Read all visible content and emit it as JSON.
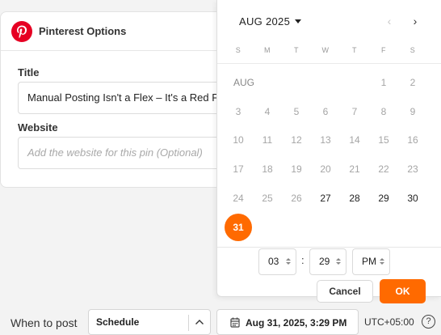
{
  "pinterest": {
    "title": "Pinterest Options",
    "fields": {
      "title_label": "Title",
      "title_value": "Manual Posting Isn't a Flex – It's a Red Flag",
      "website_label": "Website",
      "website_placeholder": "Add the website for this pin (Optional)"
    }
  },
  "calendar": {
    "month_label": "AUG 2025",
    "prev_icon": "chevron-left",
    "next_icon": "chevron-right",
    "weekdays": [
      "S",
      "M",
      "T",
      "W",
      "T",
      "F",
      "S"
    ],
    "month_abbr": "AUG",
    "weeks": [
      [
        "",
        "",
        "",
        "",
        "",
        "1",
        "2"
      ],
      [
        "3",
        "4",
        "5",
        "6",
        "7",
        "8",
        "9"
      ],
      [
        "10",
        "11",
        "12",
        "13",
        "14",
        "15",
        "16"
      ],
      [
        "17",
        "18",
        "19",
        "20",
        "21",
        "22",
        "23"
      ],
      [
        "24",
        "25",
        "26",
        "27",
        "28",
        "29",
        "30"
      ],
      [
        "31",
        "",
        "",
        "",
        "",
        "",
        ""
      ]
    ],
    "available_days": [
      "27",
      "28",
      "29",
      "30",
      "31"
    ],
    "selected_day": "31",
    "time": {
      "hour": "03",
      "separator": ":",
      "minute": "29",
      "period": "PM"
    },
    "cancel_label": "Cancel",
    "ok_label": "OK",
    "accent_color": "#ff6a00"
  },
  "bottom": {
    "when_label": "When to post",
    "schedule_value": "Schedule",
    "date_value": "Aug 31, 2025, 3:29 PM",
    "timezone": "UTC+05:00",
    "help_symbol": "?"
  }
}
